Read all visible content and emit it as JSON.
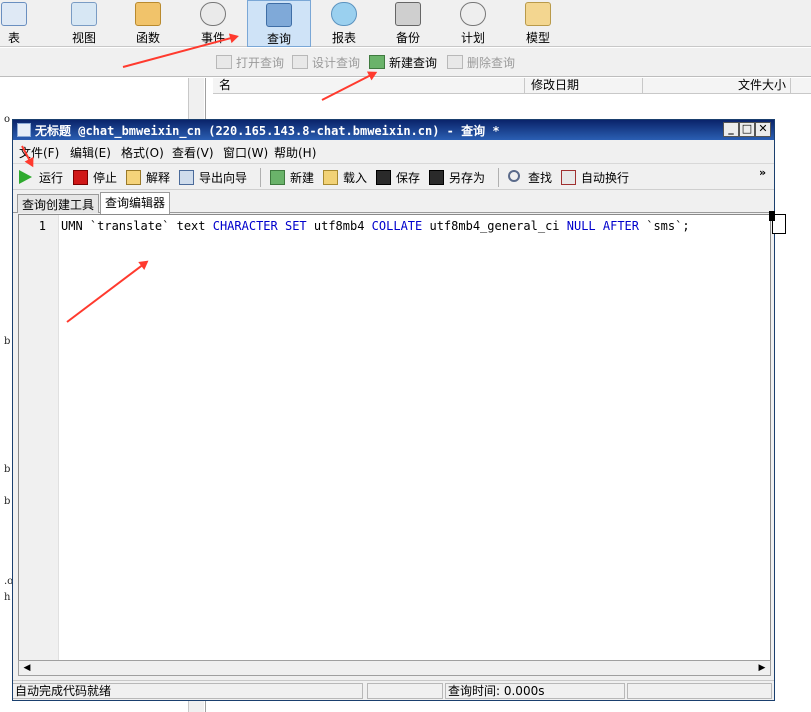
{
  "main_toolbar": {
    "items": [
      {
        "label": "表",
        "icon": "table-icon"
      },
      {
        "label": "视图",
        "icon": "view-icon"
      },
      {
        "label": "函数",
        "icon": "function-icon"
      },
      {
        "label": "事件",
        "icon": "event-icon"
      },
      {
        "label": "查询",
        "icon": "query-icon",
        "active": true
      },
      {
        "label": "报表",
        "icon": "report-icon"
      },
      {
        "label": "备份",
        "icon": "backup-icon"
      },
      {
        "label": "计划",
        "icon": "schedule-icon"
      },
      {
        "label": "模型",
        "icon": "model-icon"
      }
    ]
  },
  "sub_toolbar": {
    "open_query": "打开查询",
    "design_query": "设计查询",
    "new_query": "新建查询",
    "delete_query": "删除查询"
  },
  "file_list": {
    "columns": [
      "名",
      "修改日期",
      "文件大小"
    ]
  },
  "left_fragments": [
    "o",
    "b",
    "b",
    "b",
    ".o",
    "h"
  ],
  "query_window": {
    "title": "无标题 @chat_bmweixin_cn (220.165.143.8-chat.bmweixin.cn) - 查询 *",
    "controls": {
      "minimize": "_",
      "maximize": "□",
      "close": "✕"
    },
    "menu": [
      "文件(F)",
      "编辑(E)",
      "格式(O)",
      "查看(V)",
      "窗口(W)",
      "帮助(H)"
    ],
    "toolbar": {
      "run": "运行",
      "stop": "停止",
      "explain": "解释",
      "export_wizard": "导出向导",
      "new": "新建",
      "load": "载入",
      "save": "保存",
      "save_as": "另存为",
      "find": "查找",
      "word_wrap": "自动换行",
      "overflow": "»"
    },
    "tabs": [
      "查询创建工具",
      "查询编辑器"
    ],
    "editor": {
      "line_number": "1",
      "code_parts": {
        "p1": "UMN `translate`  text ",
        "k1": "CHARACTER SET",
        "p2": " utf8mb4 ",
        "k2": "COLLATE",
        "p3": " utf8mb4_general_ci ",
        "k3": "NULL AFTER",
        "p4": " `sms`;"
      }
    },
    "status": {
      "left": "自动完成代码就绪",
      "query_time": "查询时间: 0.000s"
    }
  },
  "colors": {
    "accent": "#0a246a",
    "keyword": "#0000cc",
    "annotation_arrow": "#ff3a2e"
  }
}
